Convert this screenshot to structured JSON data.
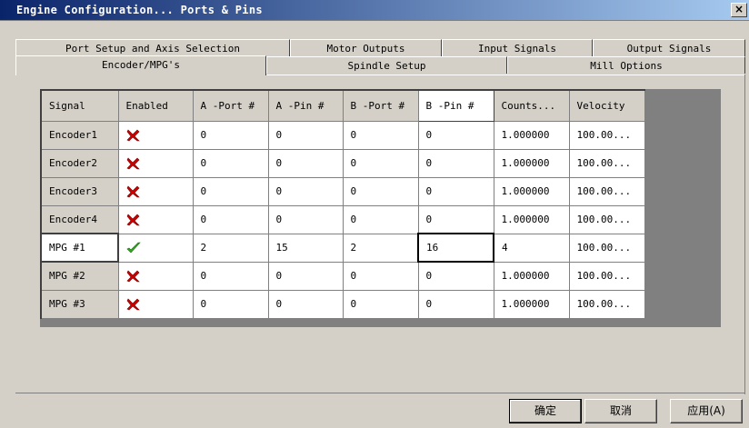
{
  "window": {
    "title": "Engine Configuration... Ports & Pins",
    "close_label": "×"
  },
  "tabs": {
    "row1": [
      "Port Setup and Axis Selection",
      "Motor Outputs",
      "Input Signals",
      "Output Signals"
    ],
    "row2": [
      "Encoder/MPG's",
      "Spindle Setup",
      "Mill Options"
    ],
    "active": "Encoder/MPG's"
  },
  "table": {
    "headers": [
      "Signal",
      "Enabled",
      "A -Port #",
      "A -Pin  #",
      "B -Port #",
      "B -Pin  #",
      "Counts...",
      "Velocity"
    ],
    "rows": [
      {
        "signal": "Encoder1",
        "enabled": false,
        "icon": "red-x-icon",
        "a_port": "0",
        "a_pin": "0",
        "b_port": "0",
        "b_pin": "0",
        "counts": "1.000000",
        "velocity": "100.00..."
      },
      {
        "signal": "Encoder2",
        "enabled": false,
        "icon": "red-x-icon",
        "a_port": "0",
        "a_pin": "0",
        "b_port": "0",
        "b_pin": "0",
        "counts": "1.000000",
        "velocity": "100.00..."
      },
      {
        "signal": "Encoder3",
        "enabled": false,
        "icon": "red-x-icon",
        "a_port": "0",
        "a_pin": "0",
        "b_port": "0",
        "b_pin": "0",
        "counts": "1.000000",
        "velocity": "100.00..."
      },
      {
        "signal": "Encoder4",
        "enabled": false,
        "icon": "red-x-icon",
        "a_port": "0",
        "a_pin": "0",
        "b_port": "0",
        "b_pin": "0",
        "counts": "1.000000",
        "velocity": "100.00..."
      },
      {
        "signal": "MPG #1",
        "enabled": true,
        "icon": "green-check-icon",
        "a_port": "2",
        "a_pin": "15",
        "b_port": "2",
        "b_pin": "16",
        "counts": "4",
        "velocity": "100.00..."
      },
      {
        "signal": "MPG #2",
        "enabled": false,
        "icon": "red-x-icon",
        "a_port": "0",
        "a_pin": "0",
        "b_port": "0",
        "b_pin": "0",
        "counts": "1.000000",
        "velocity": "100.00..."
      },
      {
        "signal": "MPG #3",
        "enabled": false,
        "icon": "red-x-icon",
        "a_port": "0",
        "a_pin": "0",
        "b_port": "0",
        "b_pin": "0",
        "counts": "1.000000",
        "velocity": "100.00..."
      }
    ]
  },
  "buttons": {
    "ok": "确定",
    "cancel": "取消",
    "apply": "应用(A)"
  },
  "colors": {
    "titlebar_start": "#0a246a",
    "titlebar_end": "#a6caf0",
    "face": "#d4d0c8",
    "disabled_icon": "#cc0000",
    "enabled_icon": "#33aa22"
  }
}
